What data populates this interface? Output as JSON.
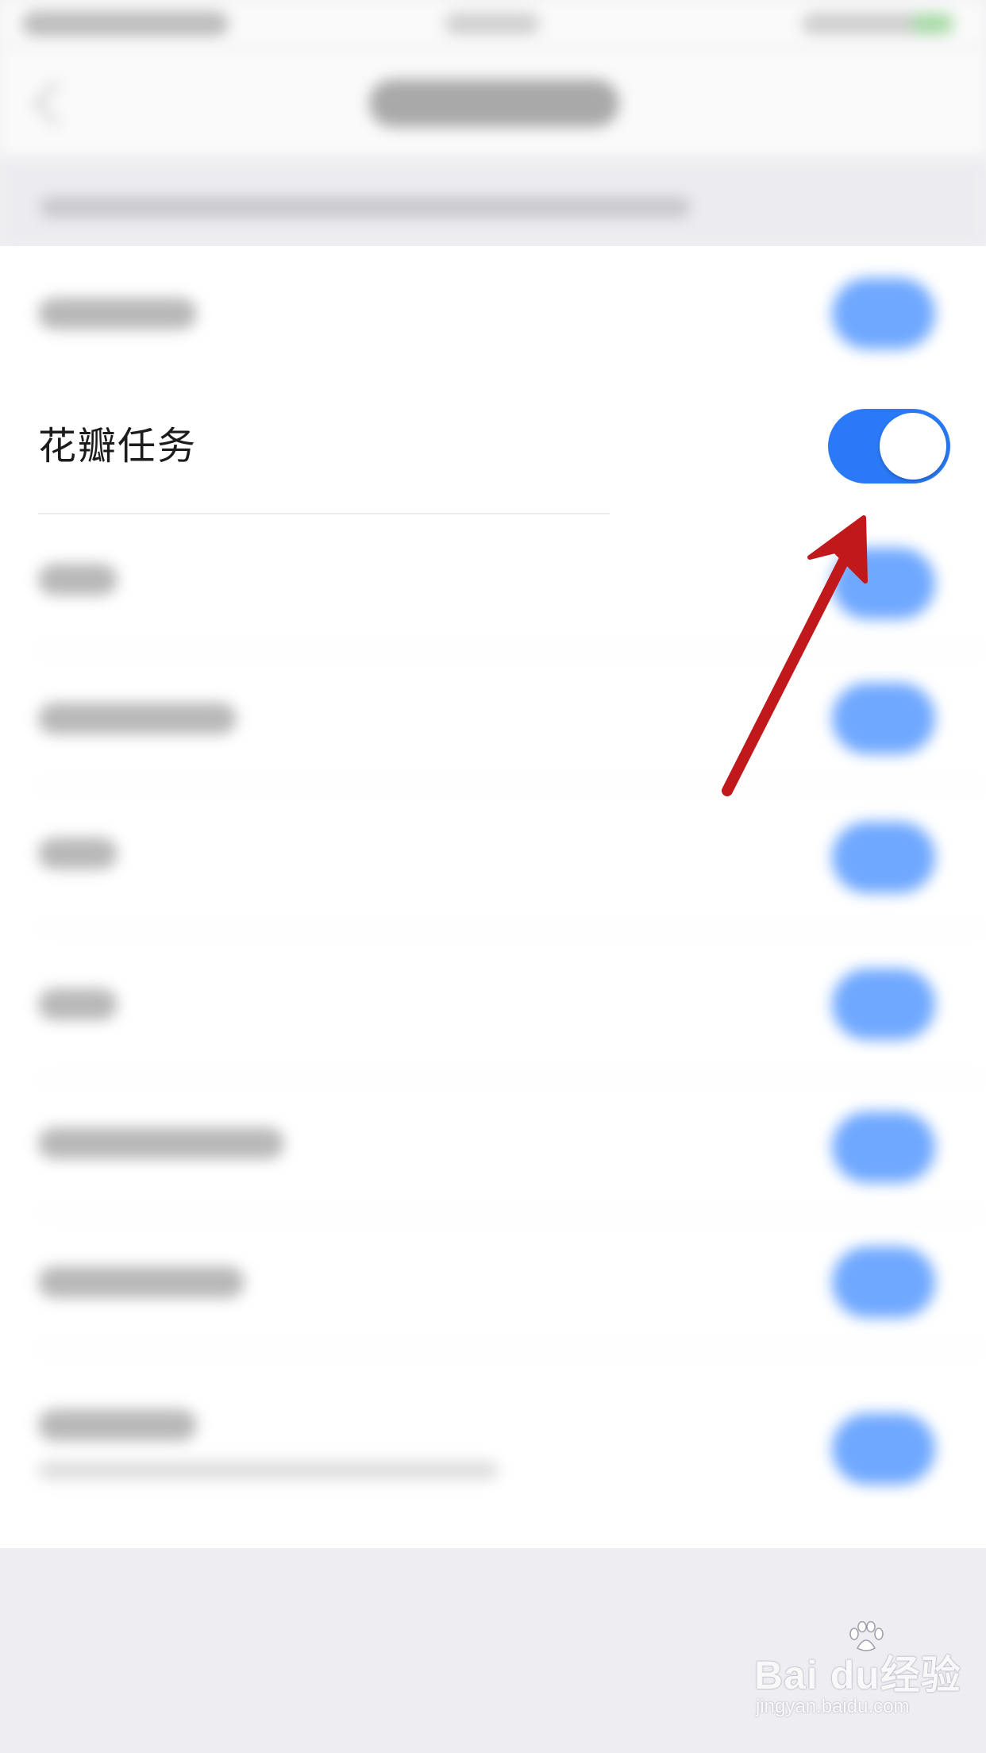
{
  "setting_row": {
    "label": "花瓣任务",
    "toggle_on": true
  },
  "colors": {
    "toggle_on": "#2a7af7",
    "annotation_arrow": "#c0181b",
    "blurred_toggle": "#6fa8ff"
  },
  "icons": {
    "annotation": "red-arrow-icon",
    "watermark_logo": "baidu-paw-icon"
  },
  "watermark": {
    "brand": "Bai du经验",
    "url": "jingyan.baidu.com"
  }
}
